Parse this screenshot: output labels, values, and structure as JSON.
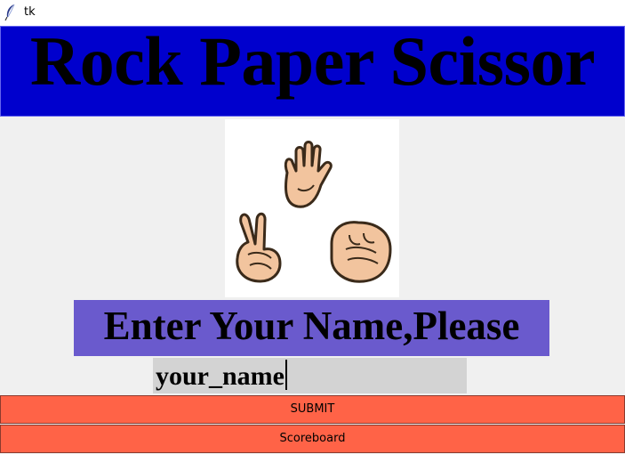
{
  "window": {
    "title": "tk",
    "icon": "tk-feather-icon"
  },
  "header": {
    "title": "Rock Paper Scissor",
    "background": "#0000cd"
  },
  "image": {
    "icon": "rock-paper-scissors-hands-image"
  },
  "prompt": {
    "text": "Enter Your Name,Please",
    "background": "#6a5acd"
  },
  "name_field": {
    "value": "your_name",
    "background": "#d3d3d3"
  },
  "buttons": {
    "submit_label": "SUBMIT",
    "scoreboard_label": "Scoreboard",
    "background": "#ff6347"
  }
}
